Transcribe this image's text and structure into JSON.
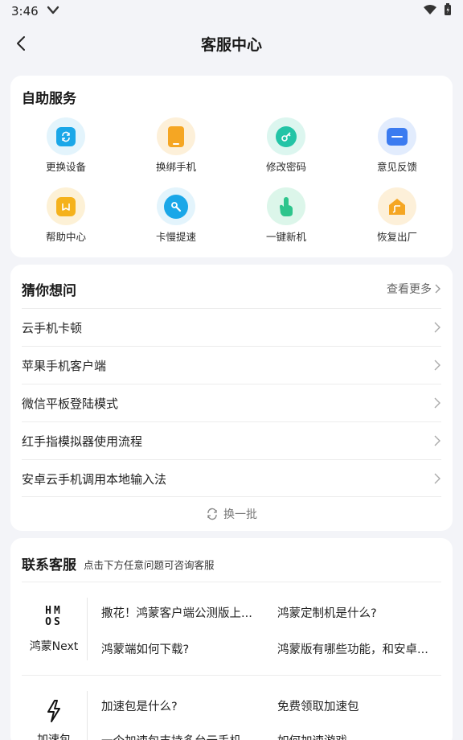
{
  "status": {
    "time": "3:46"
  },
  "header": {
    "title": "客服中心"
  },
  "self_service": {
    "title": "自助服务",
    "items": [
      {
        "label": "更换设备",
        "icon": "swap-device-icon",
        "color": "#1aa7e8",
        "bg": "#e3f4fc"
      },
      {
        "label": "换绑手机",
        "icon": "phone-icon",
        "color": "#f5a623",
        "bg": "#fdf0d9"
      },
      {
        "label": "修改密码",
        "icon": "key-icon",
        "color": "#23c4a6",
        "bg": "#dcf6ef"
      },
      {
        "label": "意见反馈",
        "icon": "feedback-box-icon",
        "color": "#3b7bf0",
        "bg": "#e2ecfd"
      },
      {
        "label": "帮助中心",
        "icon": "help-book-icon",
        "color": "#f5b21c",
        "bg": "#fdf1d6"
      },
      {
        "label": "卡慢提速",
        "icon": "wrench-icon",
        "color": "#1aa7e8",
        "bg": "#e3f4fc"
      },
      {
        "label": "一键新机",
        "icon": "tap-hand-icon",
        "color": "#2ec58c",
        "bg": "#dcf6ea"
      },
      {
        "label": "恢复出厂",
        "icon": "factory-reset-icon",
        "color": "#f5a623",
        "bg": "#fdf0d9"
      }
    ]
  },
  "guess": {
    "title": "猜你想问",
    "more_label": "查看更多",
    "questions": [
      "云手机卡顿",
      "苹果手机客户端",
      "微信平板登陆模式",
      "红手指模拟器使用流程",
      "安卓云手机调用本地输入法"
    ],
    "refresh_label": "换一批"
  },
  "contact": {
    "title": "联系客服",
    "subtitle": "点击下方任意问题可咨询客服",
    "groups": [
      {
        "logo_top": "HM",
        "logo_bottom": "OS",
        "name": "鸿蒙Next",
        "questions": [
          "撒花！鸿蒙客户端公测版上...",
          "鸿蒙定制机是什么?",
          "鸿蒙端如何下载?",
          "鸿蒙版有哪些功能，和安卓..."
        ]
      },
      {
        "name": "加速包",
        "questions": [
          "加速包是什么?",
          "免费领取加速包",
          "一个加速包支持多台云手机",
          "如何加速游戏"
        ]
      }
    ]
  }
}
